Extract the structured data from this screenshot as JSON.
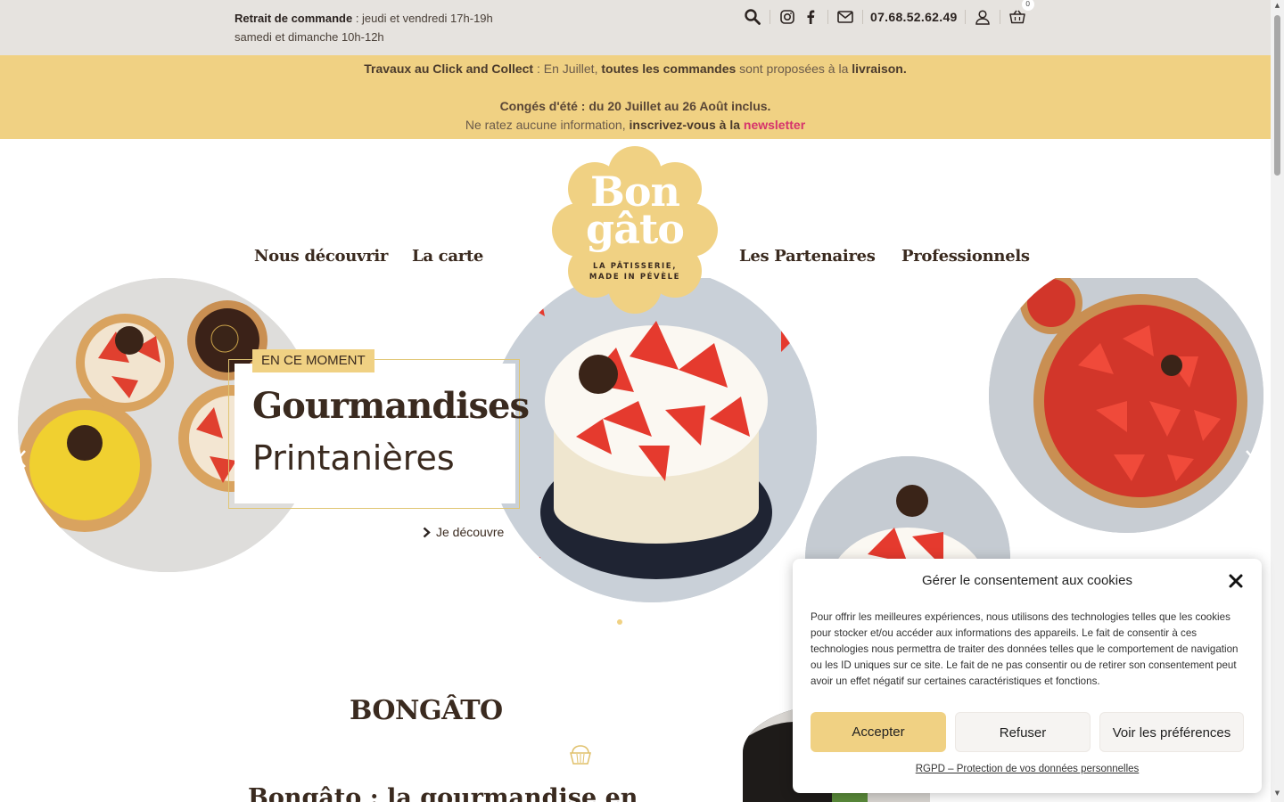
{
  "topbar": {
    "pickup_label": "Retrait de commande",
    "pickup_line1": " : jeudi et vendredi 17h-19h",
    "pickup_line2": "samedi et dimanche 10h-12h",
    "phone": "07.68.52.62.49",
    "cart_count": "0",
    "icons": [
      "search-icon",
      "instagram-icon",
      "facebook-icon",
      "mail-icon",
      "user-icon",
      "basket-icon"
    ]
  },
  "announcement": {
    "line1_a": "Travaux au Click and Collect",
    "line1_b": " : En Juillet, ",
    "line1_c": "toutes les commandes",
    "line1_d": " sont proposées à la ",
    "line1_e": "livraison.",
    "line2": "Congés d'été : du 20 Juillet au  26 Août inclus.",
    "line3_a": "Ne ratez aucune information, ",
    "line3_b": "inscrivez-vous à la ",
    "line3_c": "newsletter",
    "background": "#f0d183"
  },
  "nav": {
    "items": [
      "Nous découvrir",
      "La carte",
      "Les Partenaires",
      "Professionnels"
    ]
  },
  "logo": {
    "line1": "Bon",
    "line2": "gâto",
    "tagline1": "LA PÂTISSERIE,",
    "tagline2": "MADE IN PÉVÈLE",
    "color": "#f0d183"
  },
  "slide": {
    "tag": "EN CE MOMENT",
    "title": "Gourmandises",
    "subtitle": "Printanières",
    "cta": "Je découvre"
  },
  "section": {
    "title": "BONGÂTO",
    "subtitle": "Bongâto : la gourmandise en"
  },
  "cookie": {
    "title": "Gérer le consentement aux cookies",
    "text": "Pour offrir les meilleures expériences, nous utilisons des technologies telles que les cookies pour stocker et/ou accéder aux informations des appareils. Le fait de consentir à ces technologies nous permettra de traiter des données telles que le comportement de navigation ou les ID uniques sur ce site. Le fait de ne pas consentir ou de retirer son consentement peut avoir un effet négatif sur certaines caractéristiques et fonctions.",
    "accept": "Accepter",
    "refuse": "Refuser",
    "prefs": "Voir les préférences",
    "link": "RGPD – Protection de vos données personnelles"
  }
}
